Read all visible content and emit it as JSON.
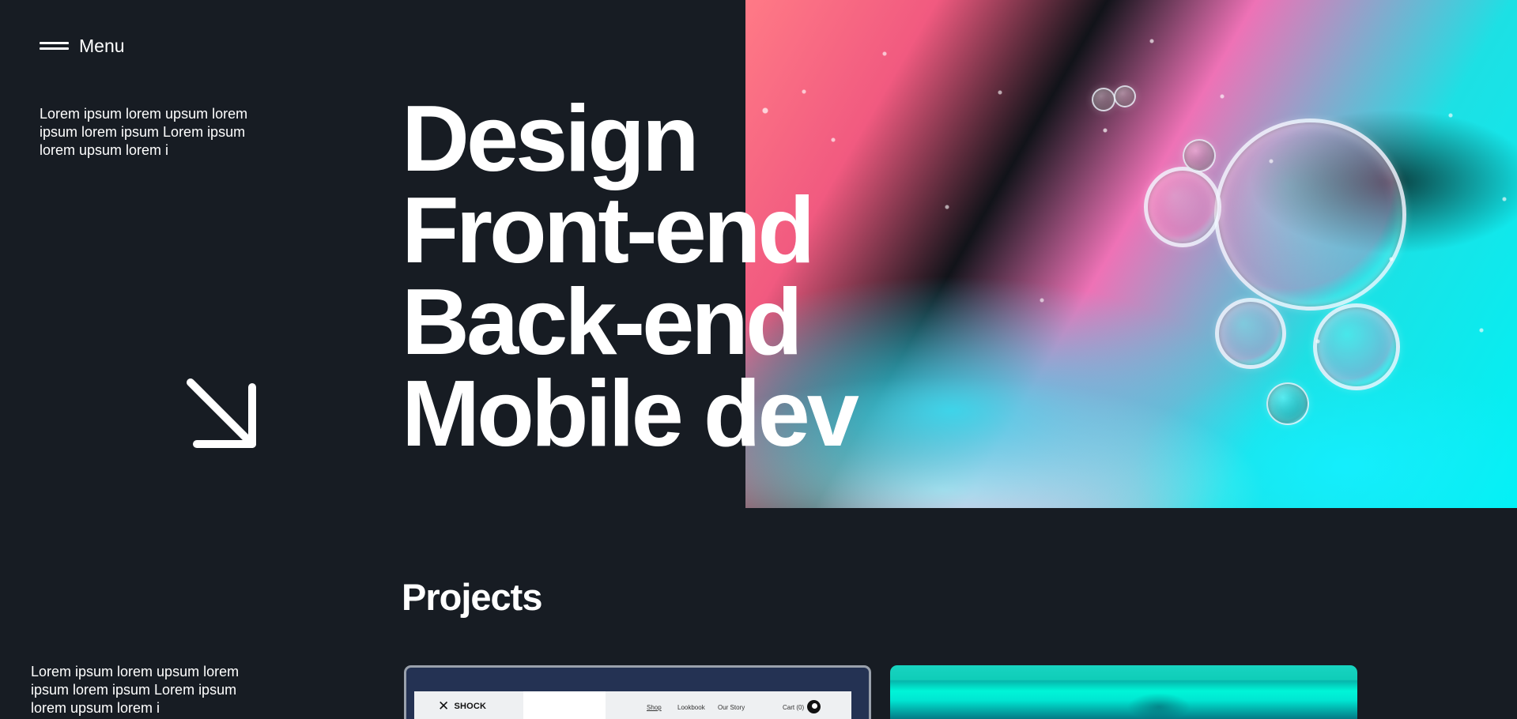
{
  "header": {
    "menu_label": "Menu",
    "menu_icon": "hamburger-icon"
  },
  "intro": {
    "text": "Lorem ipsum lorem upsum lorem ipsum lorem ipsum Lorem ipsum lorem upsum lorem i",
    "arrow_icon": "arrow-down-right-icon"
  },
  "hero": {
    "headline_lines": [
      "Design",
      "Front-end",
      "Back-end",
      "Mobile dev"
    ],
    "image_name": "hero-bubbles-image"
  },
  "projects": {
    "title": "Projects",
    "description": "Lorem ipsum lorem upsum lorem ipsum lorem ipsum Lorem ipsum lorem upsum lorem i",
    "cards": [
      {
        "logo": "SHOCK",
        "nav": [
          "Shop",
          "Lookbook",
          "Our Story",
          "Cart (0)"
        ],
        "icon": "moon-icon",
        "accent": "#243253"
      },
      {
        "accent": "#18d4c1"
      }
    ]
  },
  "colors": {
    "background": "#171c23",
    "text": "#ffffff"
  }
}
